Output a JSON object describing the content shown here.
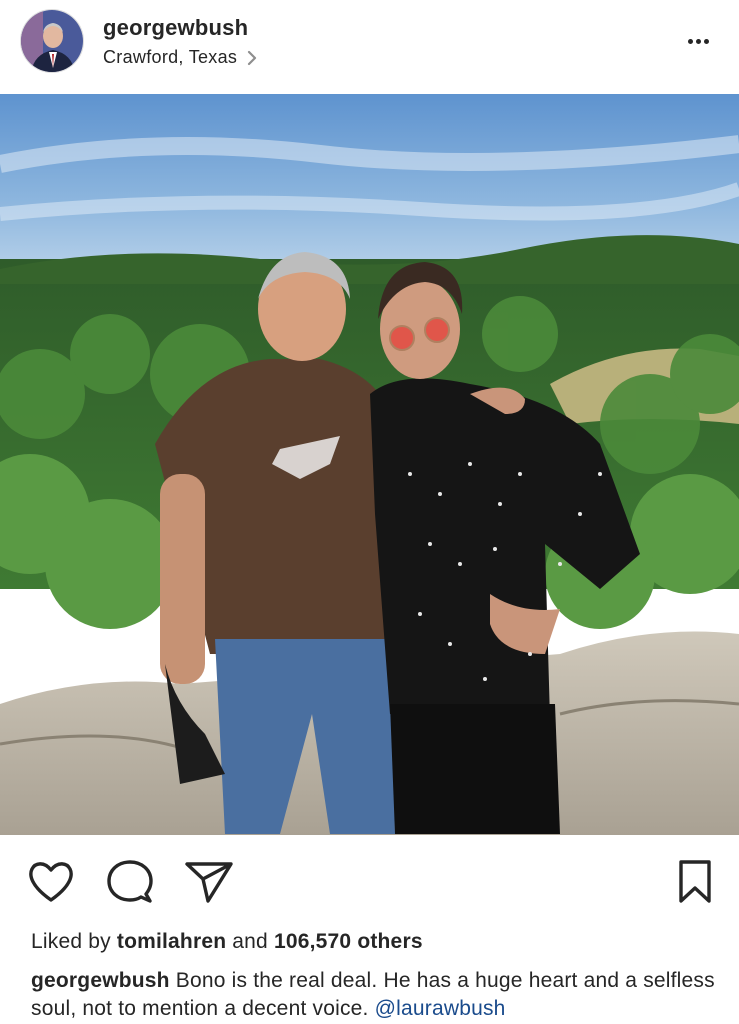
{
  "post": {
    "username": "georgewbush",
    "location": "Crawford, Texas",
    "photo_description": "",
    "likes": {
      "prefix": "Liked by",
      "liked_by_user": "tomilahren",
      "connector": "and",
      "others_count": "106,570 others"
    },
    "caption": {
      "username": "georgewbush",
      "text": " Bono is the real deal. He has a huge heart and a selfless soul, not to mention a decent voice. ",
      "mention": "@laurawbush"
    }
  },
  "icons": {
    "more": "more-horizontal-icon",
    "like": "heart-icon",
    "comment": "comment-icon",
    "share": "send-icon",
    "save": "bookmark-icon",
    "location_chevron": "chevron-right-icon"
  },
  "colors": {
    "text": "#262626",
    "mention": "#1a4b8c",
    "sky": "#6f9fd1",
    "foliage": "#3d6e2c"
  }
}
